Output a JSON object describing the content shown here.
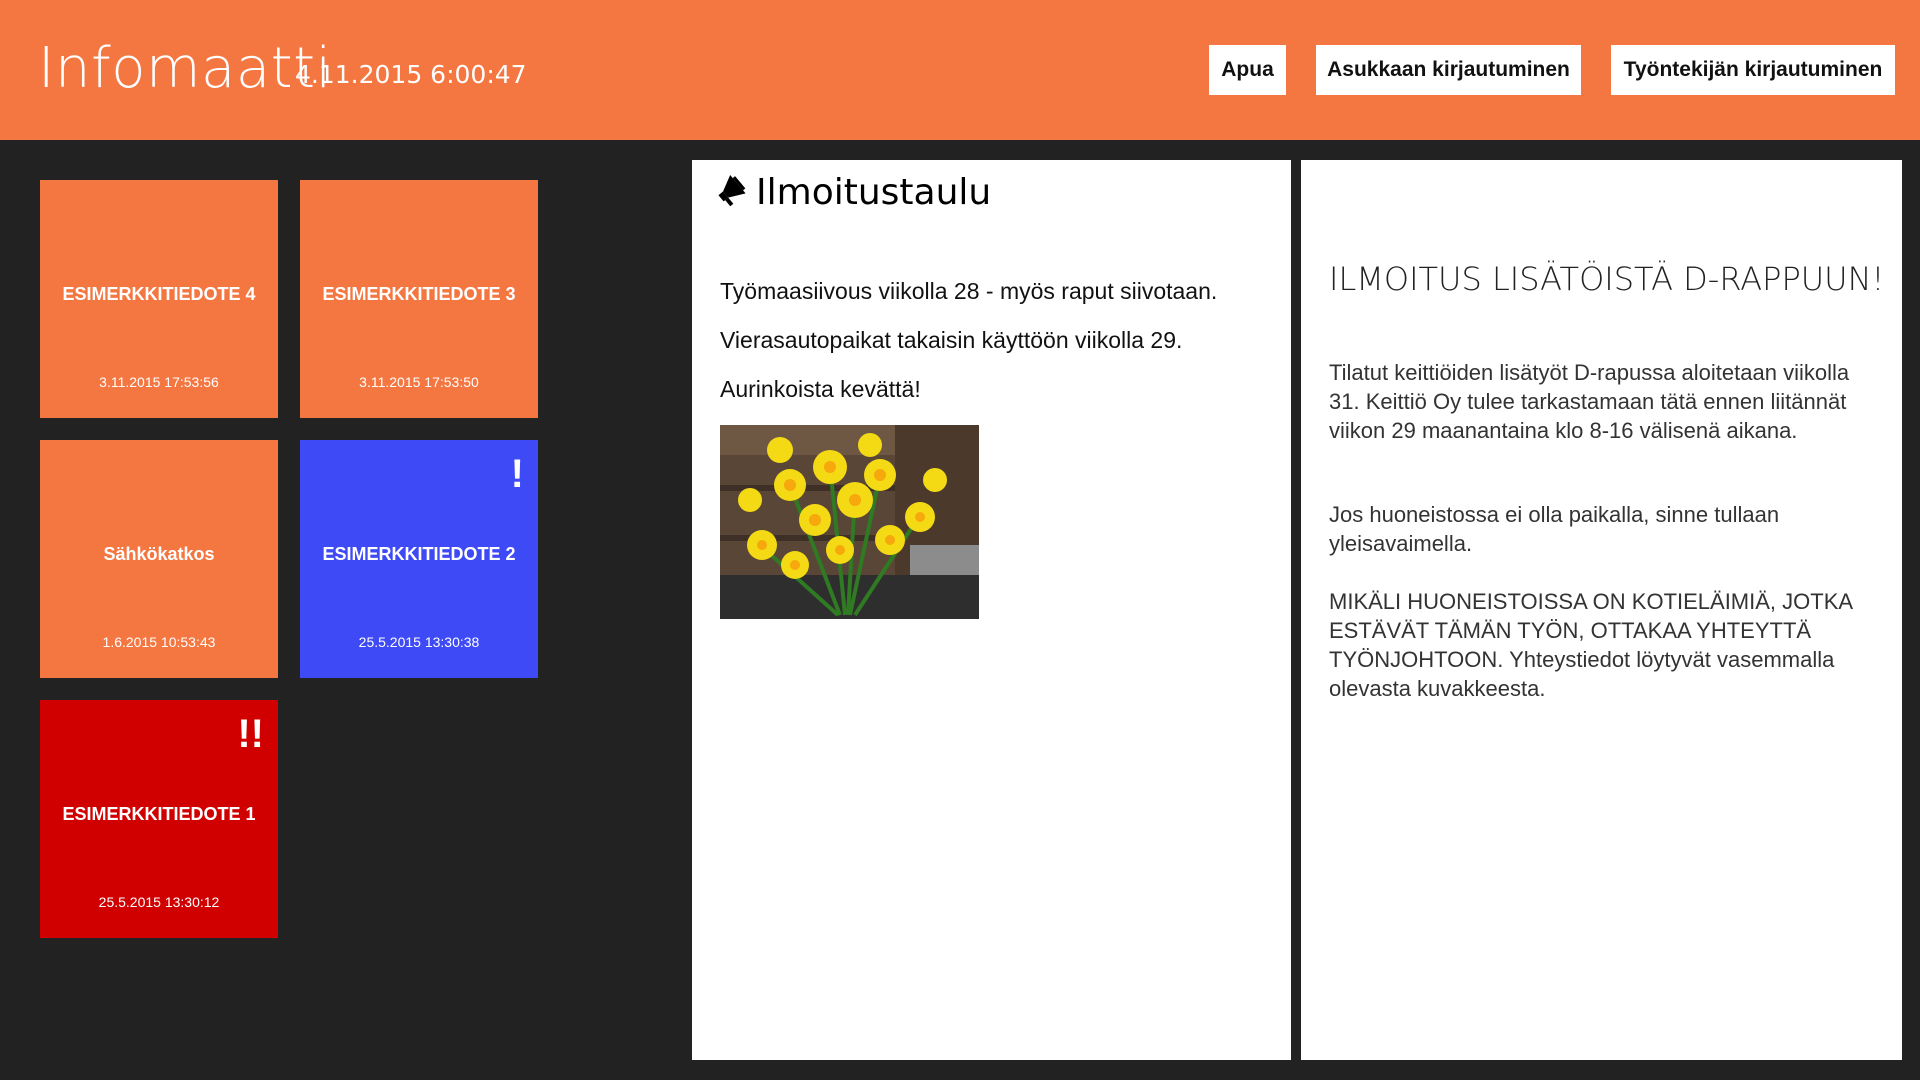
{
  "header": {
    "app_title": "Infomaatti",
    "clock": "4.11.2015 6:00:47",
    "help_label": "Apua",
    "resident_login_label": "Asukkaan kirjautuminen",
    "employee_login_label": "Työntekijän kirjautuminen",
    "color": "#F47641"
  },
  "tiles": [
    {
      "title": "ESIMERKKITIEDOTE 4",
      "date": "3.11.2015 17:53:56",
      "color": "#F47641",
      "badge": ""
    },
    {
      "title": "ESIMERKKITIEDOTE 3",
      "date": "3.11.2015 17:53:50",
      "color": "#F47641",
      "badge": ""
    },
    {
      "title": "Sähkökatkos",
      "date": "1.6.2015 10:53:43",
      "color": "#F47641",
      "badge": ""
    },
    {
      "title": "ESIMERKKITIEDOTE 2",
      "date": "25.5.2015 13:30:38",
      "color": "#3D4AF5",
      "badge": "!"
    },
    {
      "title": "ESIMERKKITIEDOTE 1",
      "date": "25.5.2015 13:30:12",
      "color": "#D10000",
      "badge": "!!"
    }
  ],
  "board": {
    "title": "Ilmoitustaulu",
    "icon": "megaphone-icon",
    "lines": [
      "Työmaasiivous viikolla 28 - myös raput siivotaan.",
      "Vierasautopaikat takaisin käyttöön viikolla 29.",
      "Aurinkoista kevättä!"
    ],
    "photo": "daffodils-photo"
  },
  "notice": {
    "title": "ILMOITUS LISÄTÖISTÄ D-RAPPUUN!",
    "paragraphs": [
      "Tilatut keittiöiden lisätyöt D-rapussa aloitetaan viikolla 31.  Keittiö Oy tulee tarkastamaan tätä ennen liitännät viikon 29 maanantaina klo 8-16 välisenä aikana.",
      "Jos huoneistossa ei olla paikalla, sinne tullaan yleisavaimella.",
      "MIKÄLI HUONEISTOISSA ON KOTIELÄIMIÄ, JOTKA ESTÄVÄT TÄMÄN TYÖN, OTTAKAA YHTEYTTÄ TYÖNJOHTOON.  Yhteystiedot löytyvät vasemmalla olevasta kuvakkeesta."
    ]
  }
}
